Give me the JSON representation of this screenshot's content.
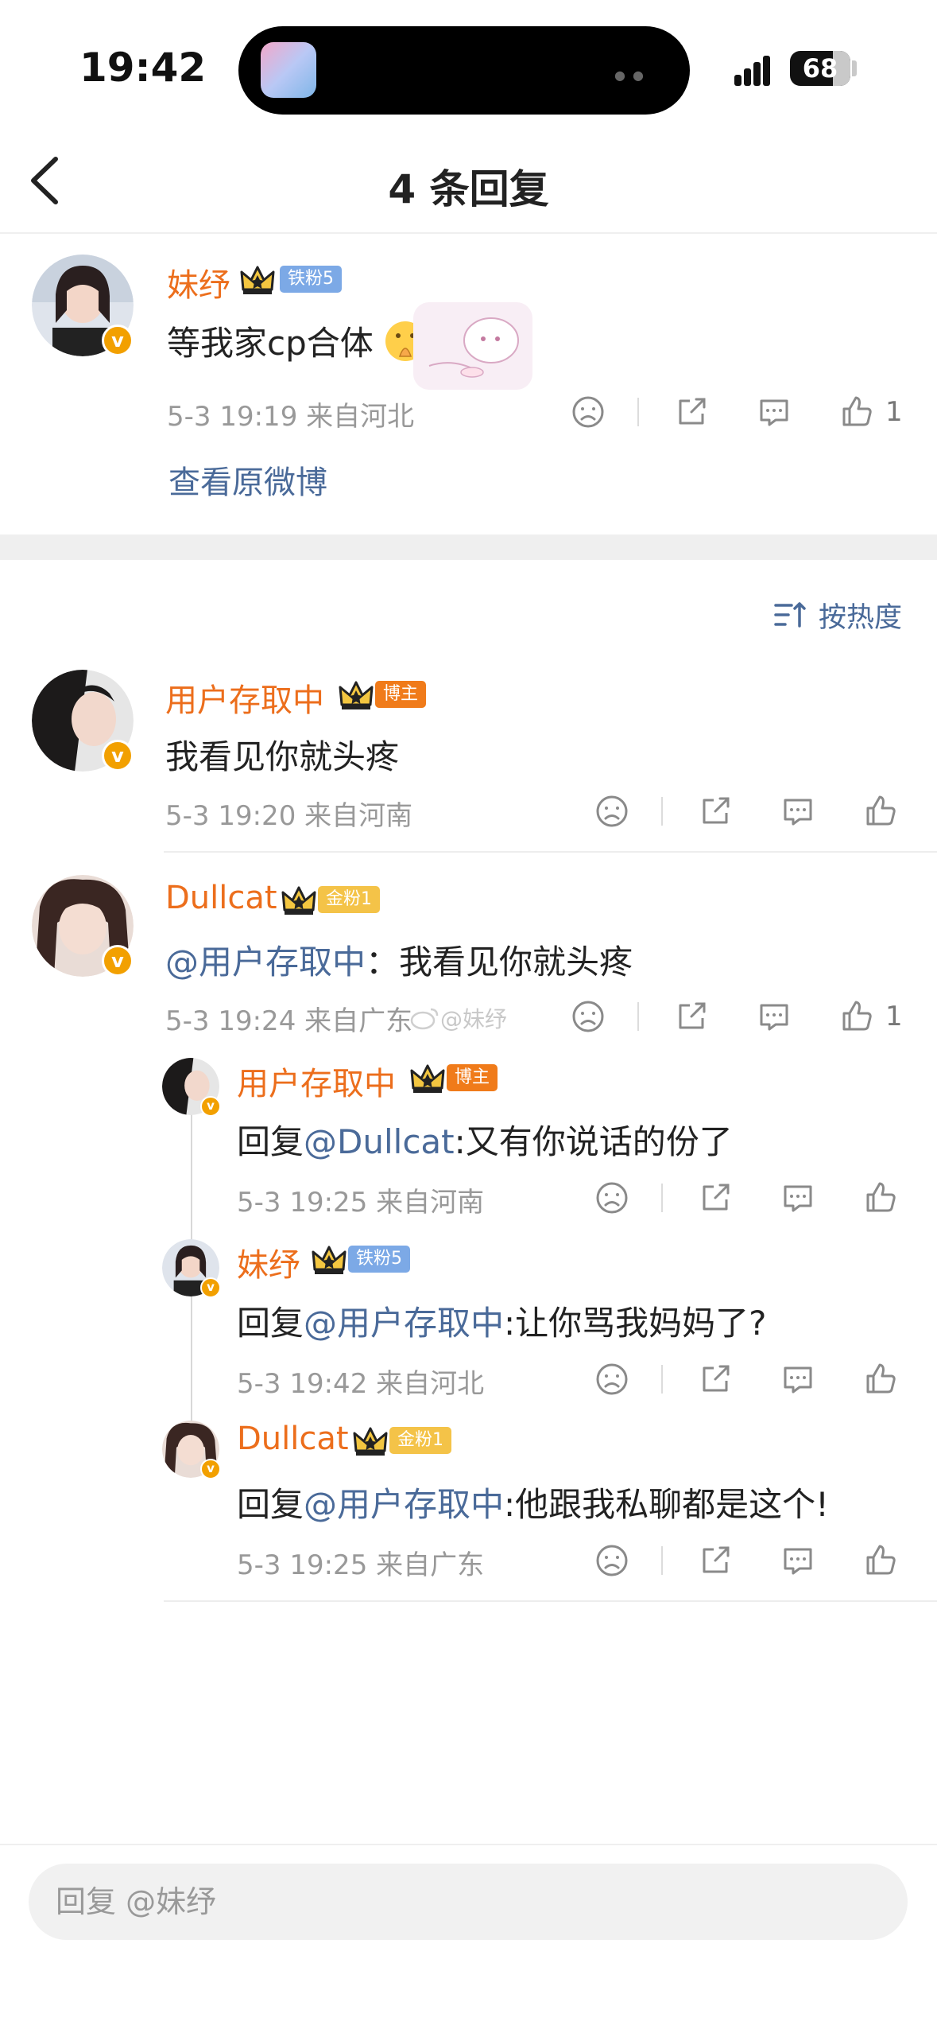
{
  "status_bar": {
    "time": "19:42",
    "battery": "68"
  },
  "nav": {
    "title": "4 条回复"
  },
  "original_comment": {
    "username": "妹纾",
    "fan_badge": "铁粉5",
    "text": "等我家cp合体",
    "meta": "5-3 19:19  来自河北",
    "like_count": "1",
    "view_original": "查看原微博"
  },
  "sort": {
    "label": "按热度"
  },
  "replies": [
    {
      "username": "用户存取中",
      "fan_badge": "博主",
      "text": "我看见你就头疼",
      "meta": "5-3 19:20  来自河南",
      "like_count": ""
    },
    {
      "username": "Dullcat",
      "fan_badge": "金粉1",
      "mention": "@用户存取中",
      "text": "：我看见你就头疼",
      "meta": "5-3 19:24  来自广东",
      "like_count": "1",
      "watermark": "@妹纾"
    }
  ],
  "nested": [
    {
      "username": "用户存取中",
      "fan_badge": "博主",
      "prefix": "回复",
      "mention": "@Dullcat",
      "text": ":又有你说话的份了",
      "meta": "5-3 19:25  来自河南"
    },
    {
      "username": "妹纾",
      "fan_badge": "铁粉5",
      "prefix": "回复",
      "mention": "@用户存取中",
      "text": ":让你骂我妈妈了?",
      "meta": "5-3 19:42  来自河北"
    },
    {
      "username": "Dullcat",
      "fan_badge": "金粉1",
      "prefix": "回复",
      "mention": "@用户存取中",
      "text": ":他跟我私聊都是这个!",
      "meta": "5-3 19:25  来自广东"
    }
  ],
  "reply_box": {
    "placeholder": "回复 @妹纾"
  },
  "colors": {
    "username": "#ec6e1c",
    "link": "#4a6a99",
    "meta": "#999999",
    "verified": "#f2a000"
  }
}
